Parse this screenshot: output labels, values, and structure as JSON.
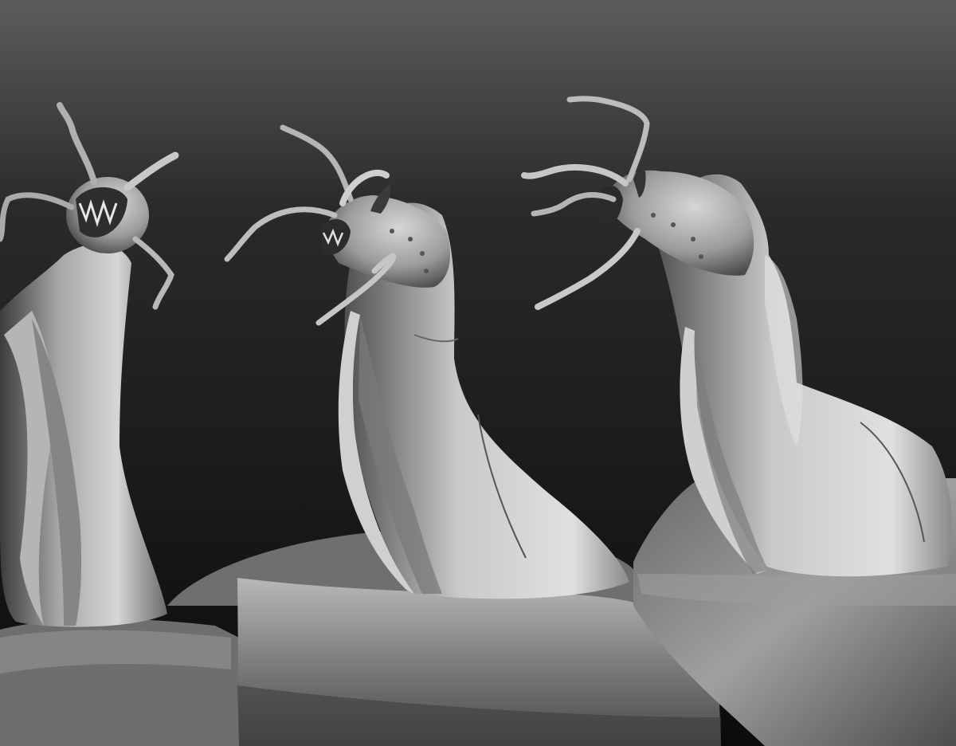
{
  "canvas": {
    "background_top": "#5c5c5c",
    "background_mid": "#262626",
    "background_bottom": "#0b0b0b",
    "material_light": "#d8d8d8",
    "material_mid": "#9a9a9a",
    "material_dark": "#3a3a3a",
    "render_style": "matcap-grey sculpt"
  },
  "models": [
    {
      "id": "creature-left",
      "view": "front"
    },
    {
      "id": "creature-center",
      "view": "three-quarter"
    },
    {
      "id": "creature-right",
      "view": "side"
    }
  ]
}
